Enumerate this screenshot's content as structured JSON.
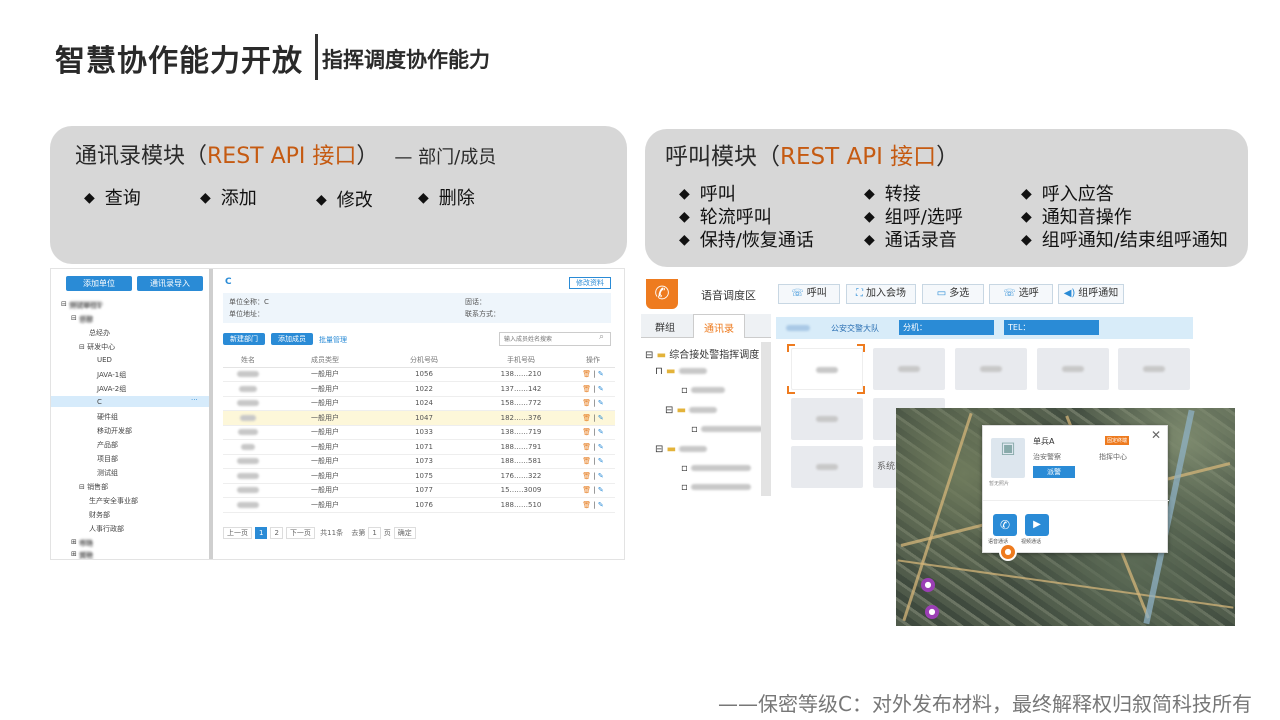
{
  "header": {
    "title": "智慧协作能力开放",
    "subtitle": "指挥调度协作能力"
  },
  "contacts_module": {
    "title_prefix": "通讯录模块（",
    "title_highlight": "REST API 接口",
    "title_suffix": "）",
    "note": "— 部门/成员",
    "bullets": [
      "查询",
      "添加",
      "修改",
      "删除"
    ]
  },
  "call_module": {
    "title_prefix": "呼叫模块（",
    "title_highlight": "REST API 接口",
    "title_suffix": "）",
    "bullets_col1": [
      "呼叫",
      "轮流呼叫",
      "保持/恢复通话"
    ],
    "bullets_col2": [
      "转接",
      "组呼/选呼",
      "通话录音"
    ],
    "bullets_col3": [
      "呼入应答",
      "通知音操作",
      "组呼通知/结束组呼通知"
    ]
  },
  "contacts_screen": {
    "add_unit_btn": "添加单位",
    "import_btn": "通讯录导入",
    "tree": [
      "测试单位1",
      "总部",
      "总经办",
      "研发中心",
      "UED",
      "JAVA-1组",
      "JAVA-2组",
      "C",
      "硬件组",
      "移动开发部",
      "产品部",
      "项目部",
      "测试组",
      "销售部",
      "生产安全事业部",
      "财务部",
      "人事行政部",
      "市场",
      "其他"
    ],
    "crumb": "C",
    "edit_info": "修改资料",
    "unit_name_label": "单位全称：C",
    "unit_addr_label": "单位地址：",
    "tel_label": "固话：",
    "contact_label": "联系方式：",
    "new_dept": "新建部门",
    "add_member": "添加成员",
    "batch_manage": "批量管理",
    "search_placeholder": "输入成员姓名搜索",
    "columns": [
      "姓名",
      "成员类型",
      "分机号码",
      "手机号码",
      "操作"
    ],
    "rows": [
      {
        "type": "一般用户",
        "ext": "1056",
        "mobile": "138……210"
      },
      {
        "type": "一般用户",
        "ext": "1022",
        "mobile": "137……142"
      },
      {
        "type": "一般用户",
        "ext": "1024",
        "mobile": "158……772"
      },
      {
        "type": "一般用户",
        "ext": "1047",
        "mobile": "182……376"
      },
      {
        "type": "一般用户",
        "ext": "1033",
        "mobile": "138……719"
      },
      {
        "type": "一般用户",
        "ext": "1071",
        "mobile": "188……791"
      },
      {
        "type": "一般用户",
        "ext": "1073",
        "mobile": "188……581"
      },
      {
        "type": "一般用户",
        "ext": "1075",
        "mobile": "176……322"
      },
      {
        "type": "一般用户",
        "ext": "1077",
        "mobile": "15……3009"
      },
      {
        "type": "一般用户",
        "ext": "1076",
        "mobile": "188……510"
      }
    ],
    "pager_prev": "上一页",
    "pager_p1": "1",
    "pager_p2": "2",
    "pager_next": "下一页",
    "pager_total": "共11条",
    "pager_goto": "去第",
    "pager_input": "1",
    "pager_page": "页",
    "pager_ok": "确定"
  },
  "dispatch_screen": {
    "title": "语音调度区",
    "tools": [
      {
        "icon": "phone-icon",
        "label": "呼叫"
      },
      {
        "icon": "meeting-icon",
        "label": "加入会场"
      },
      {
        "icon": "multi-select-icon",
        "label": "多选"
      },
      {
        "icon": "select-call-icon",
        "label": "选呼"
      },
      {
        "icon": "broadcast-icon",
        "label": "组呼通知"
      }
    ],
    "tab_group": "群组",
    "tab_contacts": "通讯录",
    "info_team": "公安交警大队",
    "info_ext": "分机：",
    "info_tel": "TEL：",
    "tree_root": "综合接处警指挥调度",
    "tile_labels": [
      "",
      "",
      "",
      "",
      "",
      "",
      "系统",
      "",
      "",
      ""
    ],
    "popup_name": "单兵A",
    "popup_badge": "固定终端",
    "popup_role": "治安警察",
    "popup_org": "指挥中心",
    "popup_photo_label": "暂无照片",
    "popup_action": "派警",
    "popup_voice": "语音通话",
    "popup_video": "视频通话"
  },
  "footer": "——保密等级C：对外发布材料，最终解释权归叙简科技所有"
}
